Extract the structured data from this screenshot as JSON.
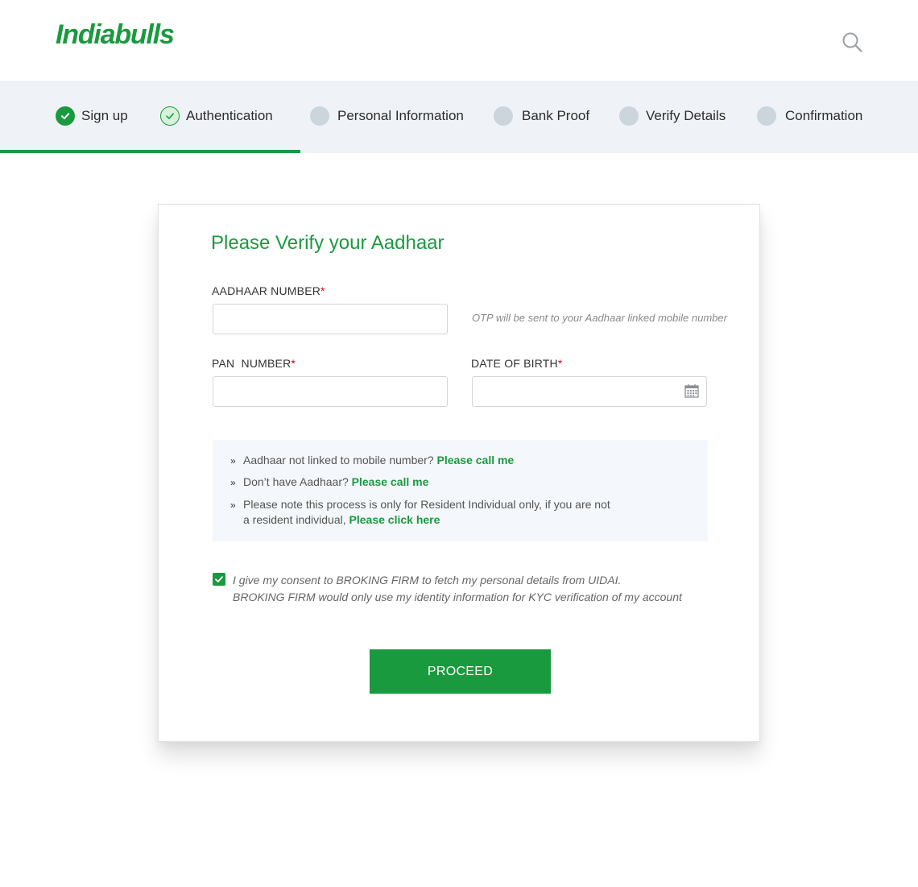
{
  "brand": {
    "logo_text": "Indiabulls",
    "accent_color": "#1a9a3e"
  },
  "header": {
    "search_icon": "search-icon"
  },
  "stepper": {
    "progress_fraction": 0.327,
    "steps": [
      {
        "label": "Sign up",
        "state": "done"
      },
      {
        "label": "Authentication",
        "state": "current"
      },
      {
        "label": "Personal Information",
        "state": "pending"
      },
      {
        "label": "Bank Proof",
        "state": "pending"
      },
      {
        "label": "Verify Details",
        "state": "pending"
      },
      {
        "label": "Confirmation",
        "state": "pending"
      }
    ]
  },
  "form": {
    "title": "Please Verify your Aadhaar",
    "aadhaar": {
      "label": "AADHAAR NUMBER",
      "required_mark": "*",
      "value": "",
      "placeholder": ""
    },
    "aadhaar_hint": "OTP will be sent to your Aadhaar linked mobile number",
    "pan": {
      "label": "PAN  NUMBER",
      "required_mark": "*",
      "value": "",
      "placeholder": ""
    },
    "dob": {
      "label": "DATE OF BIRTH",
      "required_mark": "*",
      "value": "",
      "placeholder": ""
    },
    "calendar_icon": "calendar-icon"
  },
  "info": {
    "row1_text": "Aadhaar not linked to mobile number?",
    "row1_link": "Please call me",
    "row2_text": "Don’t have Aadhaar?",
    "row2_link": "Please call me",
    "row3_line1": "Please note this process is only for Resident Individual only, if you are not",
    "row3_line2_text": "a resident individual,",
    "row3_link": "Please click here"
  },
  "consent": {
    "checked": true,
    "line1": "I give my consent to BROKING FIRM to fetch my personal details from UIDAI.",
    "line2": "BROKING FIRM would only use my identity information for KYC verification of my account"
  },
  "actions": {
    "proceed_label": "PROCEED"
  }
}
